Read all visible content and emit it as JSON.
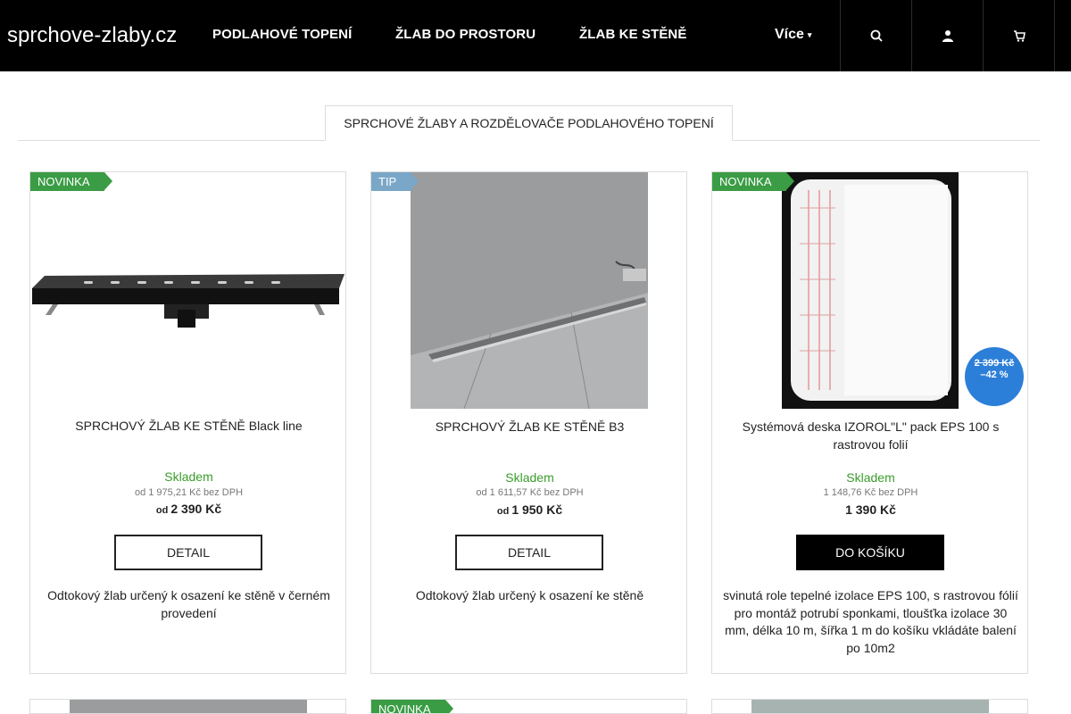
{
  "header": {
    "logo": "sprchove-zlaby.cz",
    "nav": [
      "PODLAHOVÉ TOPENÍ",
      "ŽLAB DO PROSTORU",
      "ŽLAB KE STĚNĚ"
    ],
    "more_label": "Více",
    "icons": [
      "search-icon",
      "user-icon",
      "cart-icon"
    ]
  },
  "category_tab": "SPRCHOVÉ ŽLABY A ROZDĚLOVAČE PODLAHOVÉHO TOPENÍ",
  "products": [
    {
      "flag": "NOVINKA",
      "name": "SPRCHOVÝ ŽLAB KE STĚNĚ Black line",
      "availability": "Skladem",
      "price_net": "od 1 975,21 Kč bez DPH",
      "price_prefix": "od",
      "price": "2 390 Kč",
      "button": "DETAIL",
      "description": "Odtokový žlab určený k osazení ke stěně v černém provedení"
    },
    {
      "flag": "TIP",
      "name": "SPRCHOVÝ ŽLAB KE STĚNĚ B3",
      "availability": "Skladem",
      "price_net": "od 1 611,57 Kč bez DPH",
      "price_prefix": "od",
      "price": "1 950 Kč",
      "button": "DETAIL",
      "description": "Odtokový žlab určený k osazení ke stěně"
    },
    {
      "flag": "NOVINKA",
      "name": "Systémová deska IZOROL\"L\" pack EPS 100 s rastrovou folií",
      "availability": "Skladem",
      "price_net": "1 148,76 Kč bez DPH",
      "price": "1 390 Kč",
      "button": "DO KOŠÍKU",
      "discount_old_price": "2 399 Kč",
      "discount_percent": "–42 %",
      "description": "svinutá role tepelné izolace EPS 100, s rastrovou fólií pro montáž potrubí sponkami, tloušťka izolace 30 mm, délka 10 m, šířka 1 m do košíku vkládáte balení po 10m2"
    }
  ],
  "second_row": {
    "flag": "NOVINKA"
  },
  "colors": {
    "header_bg": "#000000",
    "flag_new": "#3a9c44",
    "flag_tip": "#7aa7c7",
    "in_stock": "#3a9c2c",
    "discount_badge": "#2c7fd8"
  }
}
